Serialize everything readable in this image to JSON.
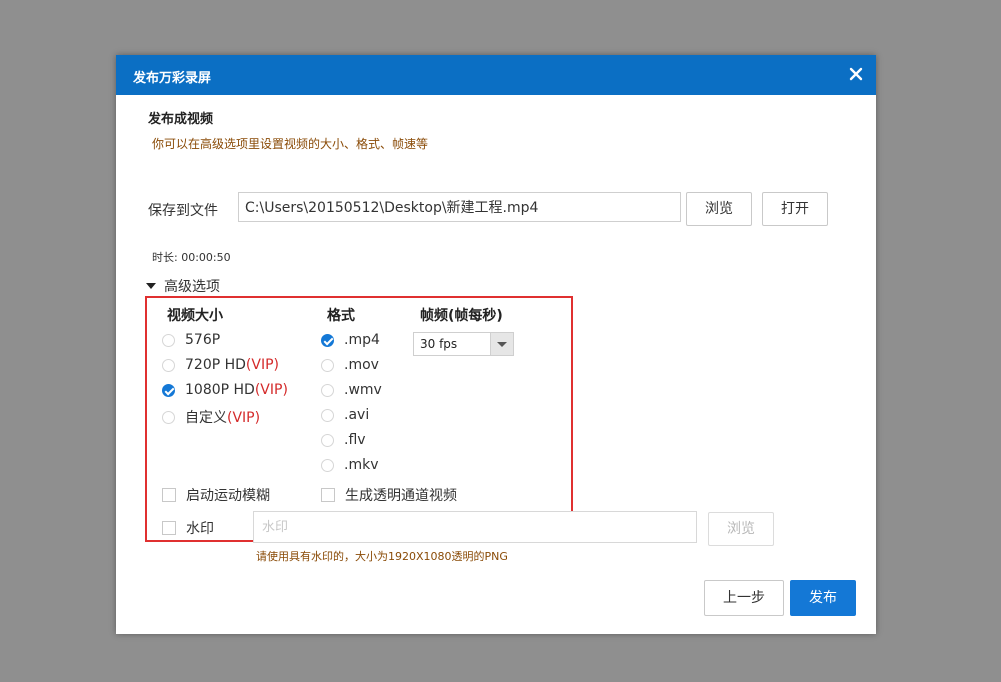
{
  "dialog": {
    "title": "发布万彩录屏",
    "close_icon": "close-icon"
  },
  "publish_section": {
    "title": "发布成视频",
    "hint": "你可以在高级选项里设置视频的大小、格式、帧速等"
  },
  "save": {
    "label": "保存到文件",
    "path": "C:\\Users\\20150512\\Desktop\\新建工程.mp4",
    "browse_label": "浏览",
    "open_label": "打开"
  },
  "duration": "时长: 00:00:50",
  "advanced": {
    "label": "高级选项",
    "expanded": true
  },
  "video_size": {
    "heading": "视频大小",
    "options": [
      {
        "label": "576P",
        "vip": "",
        "checked": false
      },
      {
        "label": "720P HD",
        "vip": "(VIP)",
        "checked": false
      },
      {
        "label": "1080P HD",
        "vip": "(VIP)",
        "checked": true
      },
      {
        "label": "自定义",
        "vip": "(VIP)",
        "checked": false
      }
    ]
  },
  "format": {
    "heading": "格式",
    "options": [
      {
        "label": ".mp4",
        "checked": true
      },
      {
        "label": ".mov",
        "checked": false
      },
      {
        "label": ".wmv",
        "checked": false
      },
      {
        "label": ".avi",
        "checked": false
      },
      {
        "label": ".flv",
        "checked": false
      },
      {
        "label": ".mkv",
        "checked": false
      }
    ]
  },
  "fps": {
    "heading": "帧频(帧每秒)",
    "selected": "30 fps"
  },
  "checkboxes": {
    "motion_blur": {
      "label": "启动运动模糊",
      "checked": false
    },
    "transparent": {
      "label": "生成透明通道视频",
      "checked": false
    }
  },
  "watermark": {
    "label": "水印",
    "checked": false,
    "placeholder": "水印",
    "browse_label": "浏览",
    "hint": "请使用具有水印的，大小为1920X1080透明的PNG"
  },
  "footer": {
    "prev_label": "上一步",
    "publish_label": "发布"
  },
  "colors": {
    "titlebar": "#0b6fc4",
    "accent": "#1478d6",
    "hint_text": "#8a4b07",
    "vip": "#d42a2a",
    "highlight_box": "#e03030",
    "backdrop": "#8f8f8f"
  }
}
